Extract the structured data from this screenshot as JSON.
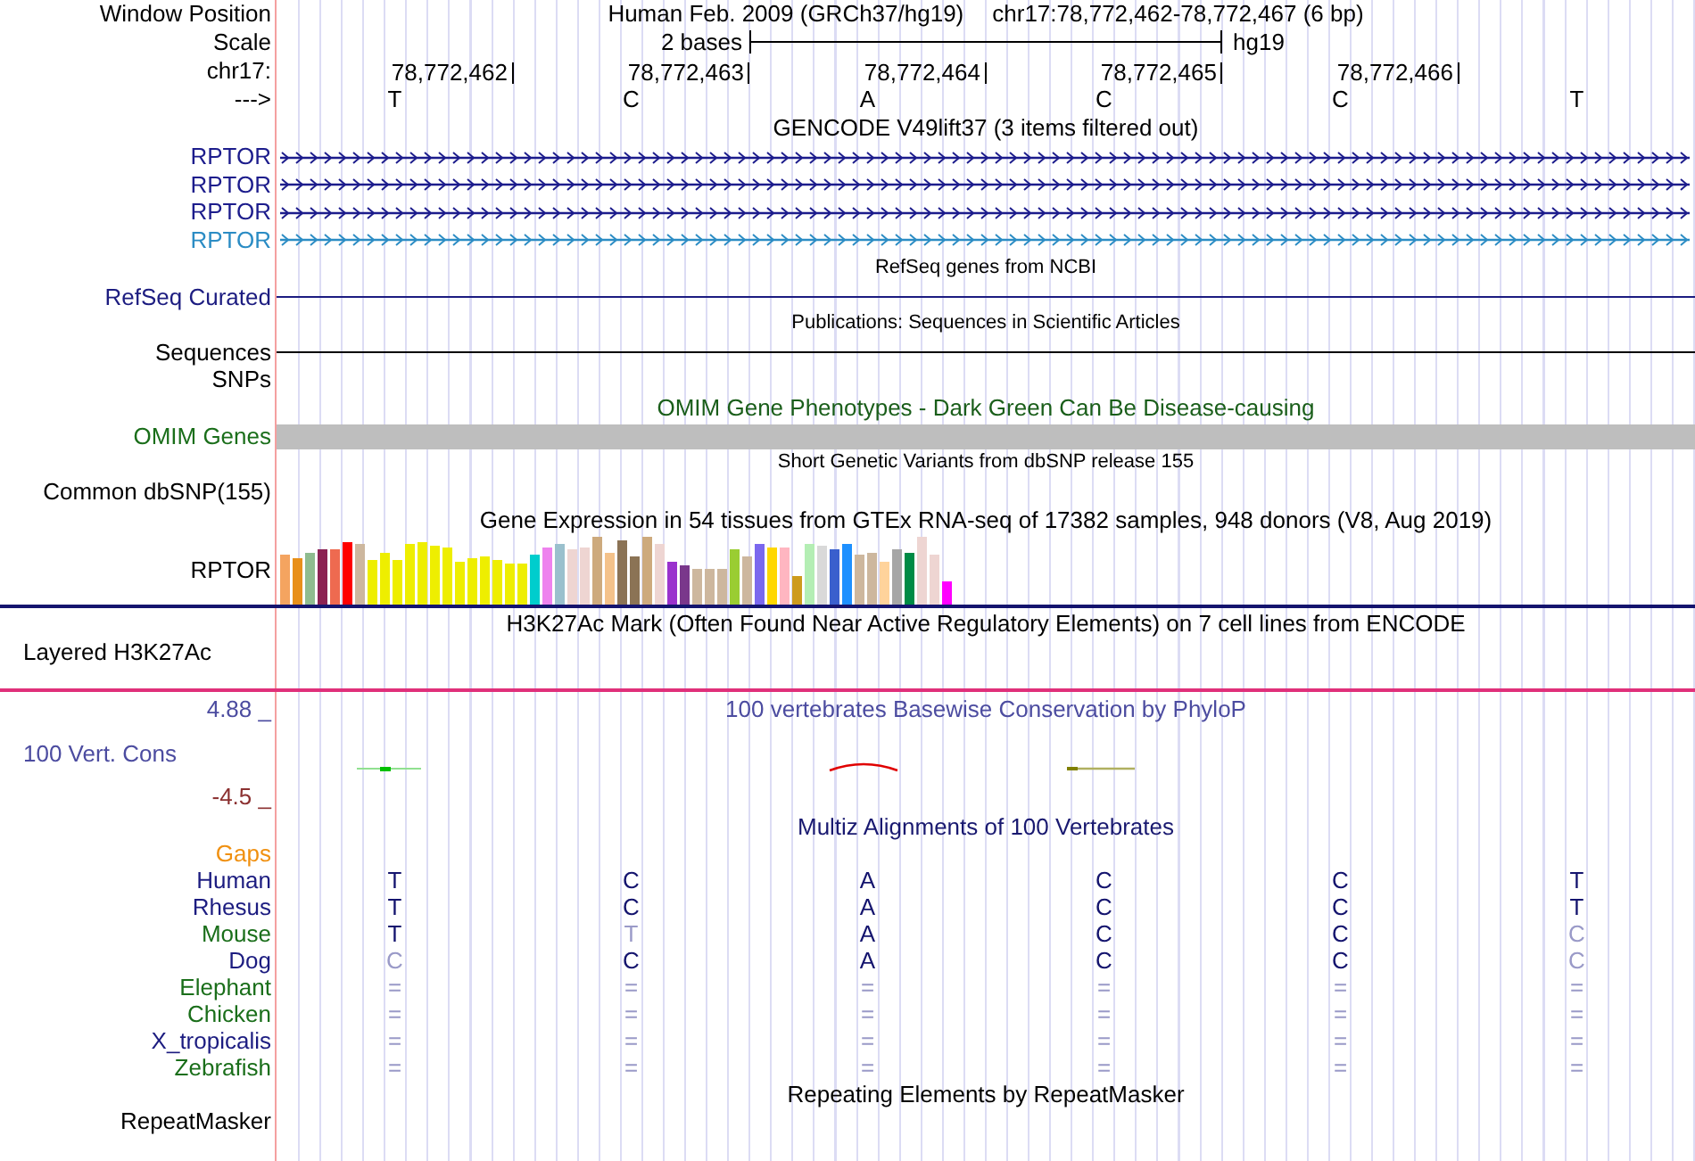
{
  "position": {
    "label": "Window Position",
    "assembly": "Human Feb. 2009 (GRCh37/hg19)",
    "range": "chr17:78,772,462-78,772,467 (6 bp)"
  },
  "scale": {
    "label": "Scale",
    "length": "2 bases",
    "assembly": "hg19"
  },
  "ruler": {
    "label": "chr17:",
    "positions": [
      "78,772,462",
      "78,772,463",
      "78,772,464",
      "78,772,465",
      "78,772,466"
    ]
  },
  "sequence": {
    "label": "--->",
    "bases": [
      "T",
      "C",
      "A",
      "C",
      "C",
      "T"
    ]
  },
  "gencode": {
    "title": "GENCODE V49lift37 (3 items filtered out)",
    "items": [
      {
        "name": "RPTOR",
        "color": "#1c1c8c"
      },
      {
        "name": "RPTOR",
        "color": "#1c1c8c"
      },
      {
        "name": "RPTOR",
        "color": "#1c1c8c"
      },
      {
        "name": "RPTOR",
        "color": "#2b8cc4"
      }
    ]
  },
  "refseq": {
    "title": "RefSeq genes from NCBI",
    "label": "RefSeq Curated"
  },
  "publications": {
    "title": "Publications: Sequences in Scientific Articles",
    "label": "Sequences"
  },
  "snps": {
    "label": "SNPs"
  },
  "omim": {
    "title": "OMIM Gene Phenotypes - Dark Green Can Be Disease-causing",
    "label": "OMIM Genes"
  },
  "dbsnp": {
    "title": "Short Genetic Variants from dbSNP release 155",
    "label": "Common dbSNP(155)"
  },
  "gtex": {
    "title": "Gene Expression in 54 tissues from GTEx RNA-seq of 17382 samples, 948 donors (V8, Aug 2019)",
    "label": "RPTOR"
  },
  "h3k27ac": {
    "title": "H3K27Ac Mark (Often Found Near Active Regulatory Elements) on 7 cell lines from ENCODE",
    "label": "Layered H3K27Ac"
  },
  "conservation": {
    "title": "100 vertebrates Basewise Conservation by PhyloP",
    "label": "100 Vert. Cons",
    "max": "4.88 _",
    "min": "-4.5 _"
  },
  "multiz": {
    "title": "Multiz Alignments of 100 Vertebrates",
    "gaps_label": "Gaps",
    "species": [
      {
        "name": "Human",
        "color": "#1c1c80",
        "bases": [
          {
            "text": "T",
            "conserved": true
          },
          {
            "text": "C",
            "conserved": true
          },
          {
            "text": "A",
            "conserved": true
          },
          {
            "text": "C",
            "conserved": true
          },
          {
            "text": "C",
            "conserved": true
          },
          {
            "text": "T",
            "conserved": true
          }
        ]
      },
      {
        "name": "Rhesus",
        "color": "#1c1c80",
        "bases": [
          {
            "text": "T",
            "conserved": true
          },
          {
            "text": "C",
            "conserved": true
          },
          {
            "text": "A",
            "conserved": true
          },
          {
            "text": "C",
            "conserved": true
          },
          {
            "text": "C",
            "conserved": true
          },
          {
            "text": "T",
            "conserved": true
          }
        ]
      },
      {
        "name": "Mouse",
        "color": "#1a6e1a",
        "bases": [
          {
            "text": "T",
            "conserved": true
          },
          {
            "text": "T",
            "conserved": false
          },
          {
            "text": "A",
            "conserved": true
          },
          {
            "text": "C",
            "conserved": true
          },
          {
            "text": "C",
            "conserved": true
          },
          {
            "text": "C",
            "conserved": false
          }
        ]
      },
      {
        "name": "Dog",
        "color": "#1c1c80",
        "bases": [
          {
            "text": "C",
            "conserved": false
          },
          {
            "text": "C",
            "conserved": true
          },
          {
            "text": "A",
            "conserved": true
          },
          {
            "text": "C",
            "conserved": true
          },
          {
            "text": "C",
            "conserved": true
          },
          {
            "text": "C",
            "conserved": false
          }
        ]
      },
      {
        "name": "Elephant",
        "color": "#1a6e1a",
        "bases": [
          {
            "text": "=",
            "conserved": false
          },
          {
            "text": "=",
            "conserved": false
          },
          {
            "text": "=",
            "conserved": false
          },
          {
            "text": "=",
            "conserved": false
          },
          {
            "text": "=",
            "conserved": false
          },
          {
            "text": "=",
            "conserved": false
          }
        ]
      },
      {
        "name": "Chicken",
        "color": "#1a6e1a",
        "bases": [
          {
            "text": "=",
            "conserved": false
          },
          {
            "text": "=",
            "conserved": false
          },
          {
            "text": "=",
            "conserved": false
          },
          {
            "text": "=",
            "conserved": false
          },
          {
            "text": "=",
            "conserved": false
          },
          {
            "text": "=",
            "conserved": false
          }
        ]
      },
      {
        "name": "X_tropicalis",
        "color": "#1c1c80",
        "bases": [
          {
            "text": "=",
            "conserved": false
          },
          {
            "text": "=",
            "conserved": false
          },
          {
            "text": "=",
            "conserved": false
          },
          {
            "text": "=",
            "conserved": false
          },
          {
            "text": "=",
            "conserved": false
          },
          {
            "text": "=",
            "conserved": false
          }
        ]
      },
      {
        "name": "Zebrafish",
        "color": "#1a6e1a",
        "bases": [
          {
            "text": "=",
            "conserved": false
          },
          {
            "text": "=",
            "conserved": false
          },
          {
            "text": "=",
            "conserved": false
          },
          {
            "text": "=",
            "conserved": false
          },
          {
            "text": "=",
            "conserved": false
          },
          {
            "text": "=",
            "conserved": false
          }
        ]
      }
    ]
  },
  "repeatmasker": {
    "title": "Repeating Elements by RepeatMasker",
    "label": "RepeatMasker"
  }
}
